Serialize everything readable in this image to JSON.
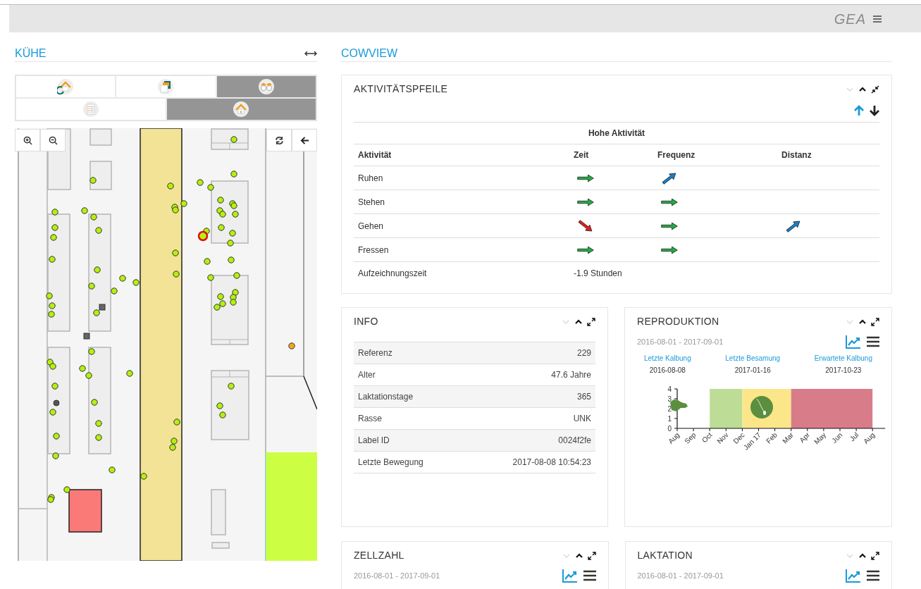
{
  "header": {
    "logo": "GEA"
  },
  "cows_panel": {
    "title": "KÜHE",
    "tab_rows": [
      [
        {
          "kind": "return-home",
          "selected": false
        },
        {
          "kind": "documents",
          "selected": false
        },
        {
          "kind": "binoculars",
          "selected": true
        }
      ],
      [
        {
          "kind": "list",
          "selected": false
        },
        {
          "kind": "home",
          "selected": true
        }
      ]
    ]
  },
  "cowview": {
    "title": "COWVIEW",
    "activity": {
      "title": "AKTIVITÄTSPFEILE",
      "direction_buttons": [
        {
          "kind": "up",
          "selected": true
        },
        {
          "kind": "down",
          "selected": false
        }
      ],
      "group_header": "Hohe Aktivität",
      "columns": [
        "Aktivität",
        "Zeit",
        "Frequenz",
        "Distanz"
      ],
      "rows": [
        {
          "label": "Ruhen",
          "cells": [
            {
              "kind": "right"
            },
            {
              "kind": "up-right"
            },
            null
          ]
        },
        {
          "label": "Stehen",
          "cells": [
            {
              "kind": "right"
            },
            {
              "kind": "right"
            },
            null
          ]
        },
        {
          "label": "Gehen",
          "cells": [
            {
              "kind": "down-right"
            },
            {
              "kind": "right"
            },
            {
              "kind": "up-right"
            }
          ]
        },
        {
          "label": "Fressen",
          "cells": [
            {
              "kind": "right"
            },
            {
              "kind": "right"
            },
            null
          ]
        }
      ],
      "footer": {
        "label": "Aufzeichnungszeit",
        "value": "-1.9 Stunden"
      }
    },
    "info": {
      "title": "INFO",
      "rows": [
        {
          "label": "Referenz",
          "value": "229"
        },
        {
          "label": "Alter",
          "value": "47.6 Jahre"
        },
        {
          "label": "Laktationstage",
          "value": "365"
        },
        {
          "label": "Rasse",
          "value": "UNK"
        },
        {
          "label": "Label ID",
          "value": "0024f2fe"
        },
        {
          "label": "Letzte Bewegung",
          "value": "2017-08-08 10:54:23"
        }
      ]
    },
    "reproduction": {
      "title": "REPRODUKTION",
      "date_range": "2016-08-01 - 2017-09-01",
      "view": [
        {
          "kind": "chart",
          "selected": true
        },
        {
          "kind": "table",
          "selected": false
        }
      ],
      "milestones": [
        {
          "label": "Letzte Kalbung",
          "date": "2016-08-08"
        },
        {
          "label": "Letzte Besamung",
          "date": "2017-01-16"
        },
        {
          "label": "Erwartete Kalbung",
          "date": "2017-10-23"
        }
      ],
      "chart_data": {
        "type": "area",
        "categories": [
          "Aug",
          "Sep",
          "Oct",
          "Nov",
          "Dec",
          "Jan 17",
          "Feb",
          "Mar",
          "Apr",
          "May",
          "Jun",
          "Jul",
          "Aug"
        ],
        "yticks": [
          0,
          1,
          2,
          3,
          4
        ],
        "ylim": [
          0,
          4
        ],
        "series": [
          {
            "color": "#bddc95",
            "values": [
              null,
              null,
              4,
              4,
              4,
              null,
              null,
              null,
              null,
              null,
              null,
              null,
              null
            ]
          },
          {
            "color": "#fce68a",
            "values": [
              null,
              null,
              null,
              null,
              4,
              4,
              4,
              4,
              null,
              null,
              null,
              null,
              null
            ]
          },
          {
            "color": "#d97c8a",
            "values": [
              null,
              null,
              null,
              null,
              null,
              null,
              null,
              4,
              4,
              4,
              4,
              4,
              4
            ]
          }
        ]
      }
    },
    "bottom_panels": [
      {
        "title": "ZELLZAHL",
        "date_range": "2016-08-01 - 2017-09-01",
        "view": [
          {
            "kind": "chart",
            "selected": true
          },
          {
            "kind": "table",
            "selected": false
          }
        ]
      },
      {
        "title": "LAKTATION",
        "date_range": "2016-08-01 - 2017-09-01",
        "view": [
          {
            "kind": "chart",
            "selected": true
          },
          {
            "kind": "table",
            "selected": false
          }
        ]
      }
    ]
  }
}
